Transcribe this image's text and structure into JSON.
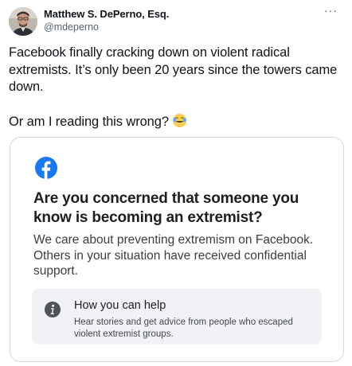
{
  "tweet": {
    "author": {
      "name": "Matthew S. DePerno, Esq.",
      "handle": "@mdeperno"
    },
    "more_label": "···",
    "text_paragraph_1": "Facebook finally cracking down on violent radical extremists. It’s only been 20 years since the towers came down.",
    "text_paragraph_2": "Or am I reading this wrong?",
    "emoji": "face-with-tears-of-joy"
  },
  "media": {
    "brand": "facebook-logo",
    "heading": "Are you concerned that someone you know is becoming an extremist?",
    "body": "We care about preventing extremism on Facebook. Others in your situation have received confidential support.",
    "help": {
      "icon": "info-icon",
      "title": "How you can help",
      "description": "Hear stories and get advice from people who escaped violent extremist groups."
    }
  },
  "colors": {
    "facebook_blue": "#1877f2",
    "tweet_text": "#0f1419",
    "secondary_text": "#536471",
    "card_border": "#cfd9de",
    "help_box_bg": "#f1f2f5"
  }
}
